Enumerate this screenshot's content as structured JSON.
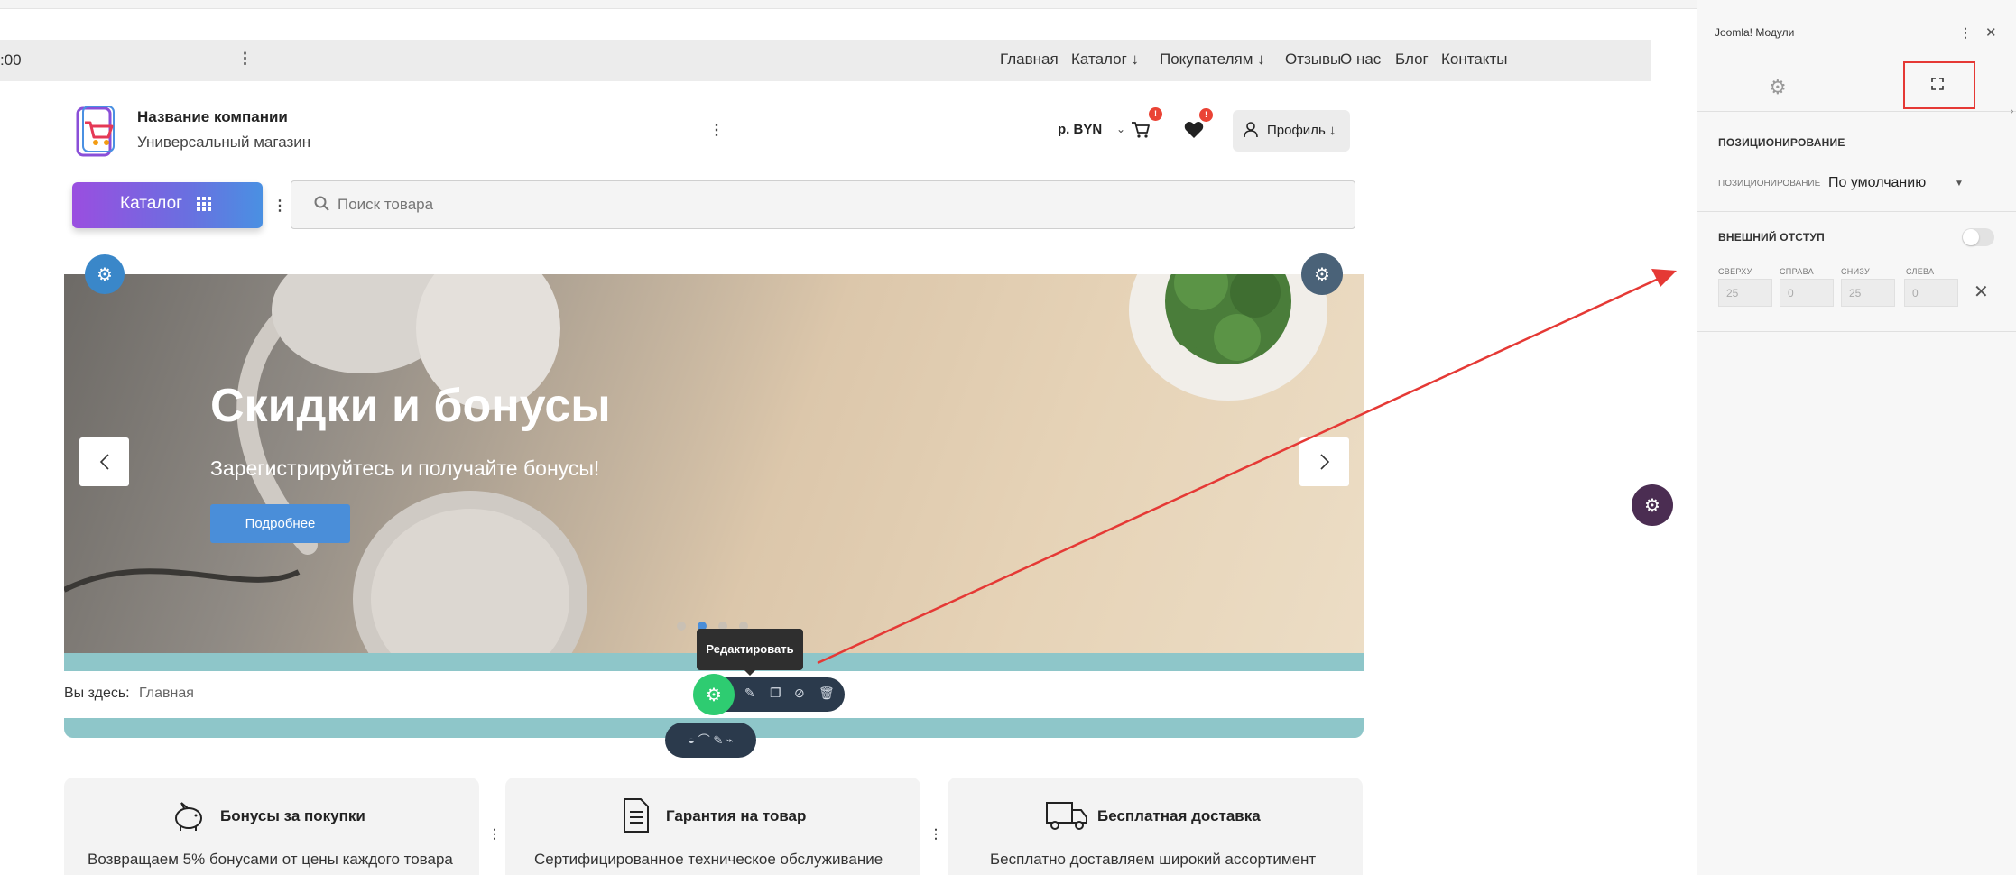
{
  "site_nav": {
    "time_text": ":00",
    "items": [
      "Главная",
      "Каталог ↓",
      "Покупателям ↓",
      "Отзывы",
      "О нас",
      "Блог",
      "Контакты"
    ]
  },
  "header": {
    "company_name": "Название компании",
    "company_sub": "Универсальный магазин",
    "currency": "р.  BYN",
    "cart_badge": "!",
    "fav_badge": "!",
    "profile_label": "Профиль ↓"
  },
  "catalog": {
    "label": "Каталог"
  },
  "search": {
    "placeholder": "Поиск товара",
    "value": ""
  },
  "banner": {
    "title": "Скидки и бонусы",
    "subtitle": "Зарегистрируйтесь и получайте бонусы!",
    "button": "Подробнее",
    "active_slide": 2,
    "slide_count": 4
  },
  "breadcrumb": {
    "label": "Вы здесь:",
    "link": "Главная"
  },
  "edit_toolbar": {
    "tooltip": "Редактировать"
  },
  "features": [
    {
      "title": "Бонусы за покупки",
      "desc": "Возвращаем 5% бонусами от цены каждого товара",
      "icon": "piggy-bank-icon"
    },
    {
      "title": "Гарантия на товар",
      "desc": "Сертифицированное техническое обслуживание",
      "icon": "document-icon"
    },
    {
      "title": "Бесплатная доставка",
      "desc": "Бесплатно доставляем широкий ассортимент",
      "icon": "truck-icon"
    }
  ],
  "panel": {
    "title": "Joomla! Модули",
    "section_positioning": "ПОЗИЦИОНИРОВАНИЕ",
    "positioning_label": "ПОЗИЦИОНИРОВАНИЕ",
    "positioning_value": "По умолчанию",
    "section_margin": "ВНЕШНИЙ ОТСТУП",
    "margin": {
      "top_label": "СВЕРХУ",
      "top_value": "25",
      "right_label": "СПРАВА",
      "right_value": "0",
      "bottom_label": "СНИЗУ",
      "bottom_value": "25",
      "left_label": "СЛЕВА",
      "left_value": "0"
    }
  },
  "colors": {
    "accent_blue": "#4a8ed9",
    "catalog_gradient_start": "#9a4ee0",
    "teal": "#8ec6c9",
    "annotation_red": "#e53935",
    "edit_green": "#2ecc71"
  }
}
